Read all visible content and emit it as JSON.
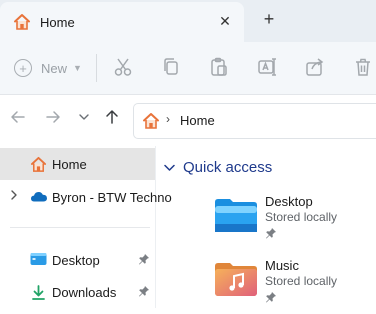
{
  "window": {
    "tab_title": "Home",
    "tab_close_symbol": "✕",
    "new_tab_symbol": "+"
  },
  "commandbar": {
    "new_label": "New",
    "icons": [
      "cut-icon",
      "copy-icon",
      "paste-icon",
      "rename-icon",
      "share-icon",
      "delete-icon"
    ]
  },
  "navigation": {
    "back_icon": "back-arrow-icon",
    "forward_icon": "forward-arrow-icon",
    "recent_icon": "chevron-down-icon",
    "up_icon": "up-arrow-icon"
  },
  "address": {
    "crumb": "Home"
  },
  "sidebar": {
    "items": [
      {
        "label": "Home",
        "icon": "home-icon",
        "selected": true
      },
      {
        "label": "Byron - BTW Techno",
        "icon": "onedrive-cloud-icon",
        "expandable": true
      },
      {
        "label": "Desktop",
        "icon": "desktop-icon",
        "pinned": true
      },
      {
        "label": "Downloads",
        "icon": "downloads-icon",
        "pinned": true
      }
    ]
  },
  "main": {
    "section_title": "Quick access",
    "folders": [
      {
        "name": "Desktop",
        "status": "Stored locally",
        "icon": "desktop-folder-icon",
        "pinned": true
      },
      {
        "name": "Music",
        "status": "Stored locally",
        "icon": "music-folder-icon",
        "pinned": true
      }
    ]
  },
  "colors": {
    "accent": "#1f3a8c",
    "home_orange": "#e8733a",
    "onedrive_blue": "#0f6cbd",
    "selected_bg": "#e5e5e5",
    "tab_strip_bg": "#e9eef3"
  }
}
